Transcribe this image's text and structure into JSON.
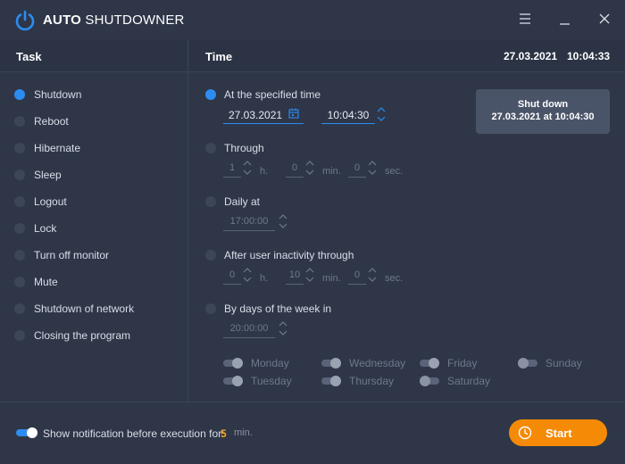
{
  "app": {
    "title_bold": "AUTO",
    "title_rest": " SHUTDOWNER",
    "icons": {
      "logo": "power-icon",
      "menu": "hamburger-icon",
      "minimize": "minimize-icon",
      "close": "close-icon"
    }
  },
  "colors": {
    "accent": "#2d8cf0",
    "start": "#f58a07",
    "background": "#2e3648",
    "value_highlight": "#f7a21b"
  },
  "task_panel": {
    "header": "Task",
    "items": [
      {
        "label": "Shutdown",
        "selected": true
      },
      {
        "label": "Reboot",
        "selected": false
      },
      {
        "label": "Hibernate",
        "selected": false
      },
      {
        "label": "Sleep",
        "selected": false
      },
      {
        "label": "Logout",
        "selected": false
      },
      {
        "label": "Lock",
        "selected": false
      },
      {
        "label": "Turn off monitor",
        "selected": false
      },
      {
        "label": "Mute",
        "selected": false
      },
      {
        "label": "Shutdown of network",
        "selected": false
      },
      {
        "label": "Closing the program",
        "selected": false
      }
    ]
  },
  "time_panel": {
    "header": "Time",
    "current_date": "27.03.2021",
    "current_time": "10:04:33",
    "specified": {
      "label": "At the specified time",
      "selected": true,
      "date": "27.03.2021",
      "time": "10:04:30",
      "calendar_icon": "calendar-icon"
    },
    "through": {
      "label": "Through",
      "selected": false,
      "h": "1",
      "h_unit": "h.",
      "min": "0",
      "min_unit": "min.",
      "sec": "0",
      "sec_unit": "sec."
    },
    "daily": {
      "label": "Daily at",
      "selected": false,
      "time": "17:00:00"
    },
    "inactivity": {
      "label": "After user inactivity through",
      "selected": false,
      "h": "0",
      "h_unit": "h.",
      "min": "10",
      "min_unit": "min.",
      "sec": "0",
      "sec_unit": "sec."
    },
    "days": {
      "label": "By days of the week in",
      "selected": false,
      "time": "20:00:00"
    },
    "weekdays": [
      {
        "label": "Monday",
        "enabled": true
      },
      {
        "label": "Tuesday",
        "enabled": true
      },
      {
        "label": "Wednesday",
        "enabled": true
      },
      {
        "label": "Thursday",
        "enabled": true
      },
      {
        "label": "Friday",
        "enabled": true
      },
      {
        "label": "Saturday",
        "enabled": false
      },
      {
        "label": "Sunday",
        "enabled": false
      }
    ],
    "summary": {
      "line1": "Shut down",
      "line2": "27.03.2021 at 10:04:30"
    }
  },
  "footer": {
    "notify_enabled": true,
    "notify_label": "Show notification before execution for:",
    "notify_minutes": "5",
    "notify_unit": "min.",
    "start_label": "Start",
    "start_icon": "clock-icon"
  }
}
